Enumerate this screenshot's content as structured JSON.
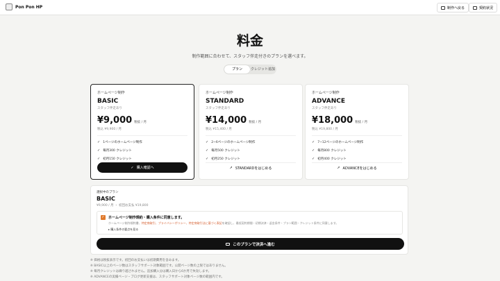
{
  "header": {
    "brand": "Pon Pon HP",
    "back_label": "制作へ戻る",
    "contract_label": "契約状況"
  },
  "hero": {
    "title": "料金",
    "subtitle": "制作範囲に合わせて、スタッフ伴走付きのプランを選べます。",
    "tabs": [
      "プラン",
      "クレジット追加"
    ]
  },
  "plans": [
    {
      "category": "ホームページ制作",
      "name": "BASIC",
      "desc": "スタッフ伴走あり",
      "price": "¥9,000",
      "unit": "税抜 / 月",
      "tax_in": "税込 ¥9,900 / 月",
      "features": [
        "1ページのホームページ制作",
        "毎月300 クレジット",
        "初月150 クレジット"
      ],
      "button": "購入確認へ"
    },
    {
      "category": "ホームページ制作",
      "name": "STANDARD",
      "desc": "スタッフ伴走あり",
      "price": "¥14,000",
      "unit": "税抜 / 月",
      "tax_in": "税込 ¥15,400 / 月",
      "features": [
        "2~6ページのホームページ制作",
        "毎月500 クレジット",
        "初月250 クレジット"
      ],
      "button": "STANDARDをはじめる"
    },
    {
      "category": "ホームページ制作",
      "name": "ADVANCE",
      "desc": "スタッフ伴走あり",
      "price": "¥18,000",
      "unit": "税抜 / 月",
      "tax_in": "税込 ¥19,800 / 月",
      "features": [
        "7~12ページのホームページ制作",
        "毎月800 クレジット",
        "初月400 クレジット"
      ],
      "button": "ADVANCEをはじめる"
    }
  ],
  "detail": {
    "category": "選択中のプラン",
    "name": "BASIC",
    "price": "¥9,900 / 月 ・ 初回お支払 ¥19,800",
    "agree_title": "ホームページ制作規約・購入条件に同意します。",
    "agree_note_pre": "ホームページ制作規約書、",
    "agree_note_hl": "特定商取引、プライバシーポリシー、特定商取引法に基づく表記",
    "agree_note_post": "を確認し、最低契約期間・初期決済・返金条件・プラン範囲・クレジット条件に同意します。",
    "agree_link": "購入条件の要点を見る",
    "pay_button": "このプランで決済へ進む"
  },
  "notes": [
    "※ 価格は税抜表示です。初回のお支払いは初期費用を含みます。",
    "※ BASIC以上のページ数はスタッフサポート対象範囲です。公開ページ数の上限ではありません。",
    "※ 毎月クレジットは繰り越されません。追加購入分は購入日から6か月で失効します。",
    "※ ADVANCEの実績ページ・ブログ更新支援は、スタッフサポート対象ページ数の範囲内です。"
  ]
}
